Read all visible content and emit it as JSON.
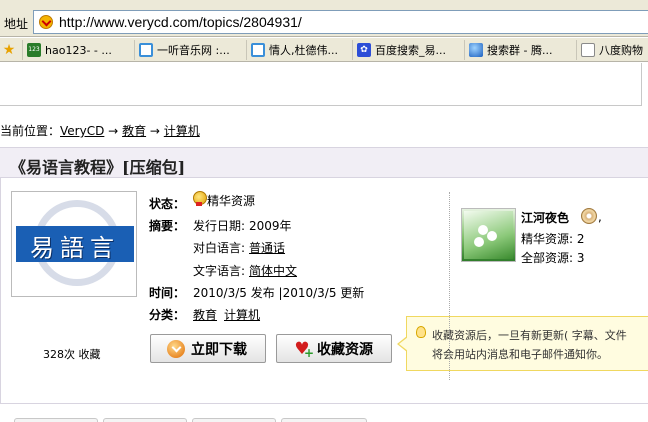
{
  "addressbar": {
    "label": "地址",
    "url": "http://www.verycd.com/topics/2804931/"
  },
  "favorites": [
    {
      "label": "hao123- - ...",
      "icon": "hao123-icon"
    },
    {
      "label": "一听音乐网 :...",
      "icon": "ie-page-icon"
    },
    {
      "label": "情人,杜德伟...",
      "icon": "ie-page-icon"
    },
    {
      "label": "百度搜索_易...",
      "icon": "baidu-paw-icon"
    },
    {
      "label": "搜索群 - 腾...",
      "icon": "globe-icon"
    },
    {
      "label": "八度购物",
      "icon": "page-icon"
    }
  ],
  "breadcrumb": {
    "prefix": "当前位置：",
    "items": [
      "VeryCD",
      "教育",
      "计算机"
    ],
    "separator": "→"
  },
  "resource": {
    "title": "《易语言教程》[压缩包]",
    "cover_text": "易語言",
    "favorite_count": "328次 收藏",
    "fields": {
      "status_label": "状态：",
      "status_value": "精华资源",
      "summary_label": "摘要：",
      "release_label": "发行日期:",
      "release_value": "2009年",
      "dialogue_label": "对白语言:",
      "dialogue_value": "普通话",
      "text_lang_label": "文字语言:",
      "text_lang_value": "简体中文",
      "time_label": "时间：",
      "time_value": "2010/3/5 发布 |2010/3/5 更新",
      "category_label": "分类：",
      "category_1": "教育",
      "category_2": "计算机"
    },
    "download_button": "立即下载",
    "collect_button": "收藏资源"
  },
  "tooltip": {
    "line1": "收藏资源后，一旦有新更新( 字幕、文件",
    "line2": "将会用站内消息和电子邮件通知你。"
  },
  "uploader": {
    "name": "江河夜色",
    "comma": ",",
    "featured": "精华资源: 2",
    "total": "全部资源: 3"
  }
}
